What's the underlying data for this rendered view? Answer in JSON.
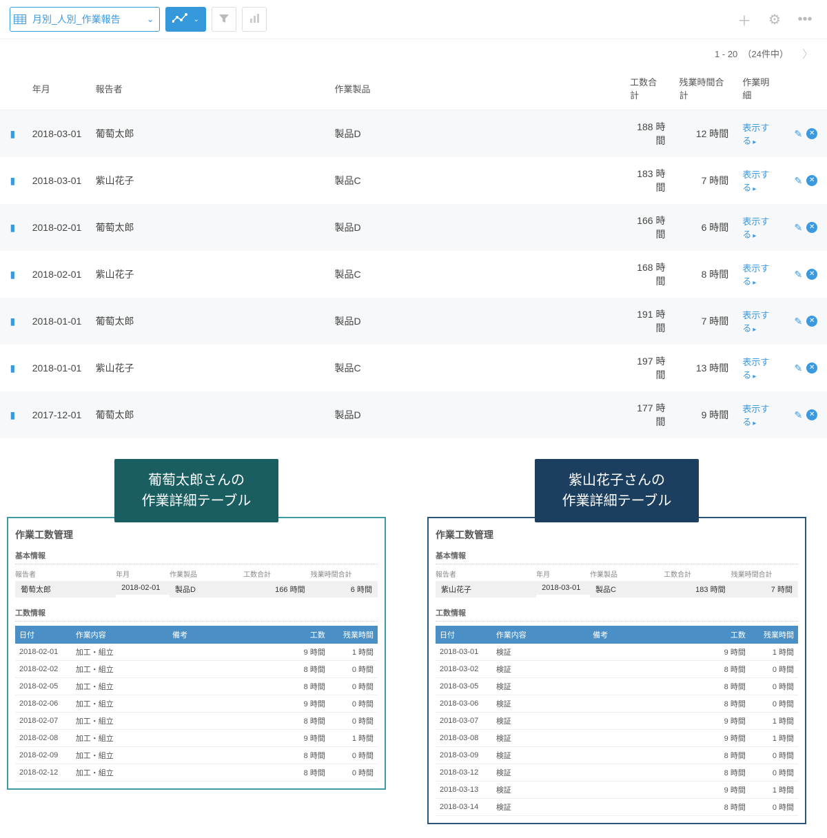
{
  "toolbar": {
    "view_label": "月別_人別_作業報告"
  },
  "pager": {
    "range": "1 - 20",
    "total_label": "（24件中）"
  },
  "columns": {
    "date": "年月",
    "reporter": "報告者",
    "product": "作業製品",
    "hours": "工数合計",
    "overtime": "残業時間合計",
    "detail": "作業明細"
  },
  "detail_link_label": "表示する",
  "unit_hours": "時間",
  "rows": [
    {
      "date": "2018-03-01",
      "reporter": "葡萄太郎",
      "product": "製品D",
      "hours": "188",
      "overtime": "12"
    },
    {
      "date": "2018-03-01",
      "reporter": "紫山花子",
      "product": "製品C",
      "hours": "183",
      "overtime": "7"
    },
    {
      "date": "2018-02-01",
      "reporter": "葡萄太郎",
      "product": "製品D",
      "hours": "166",
      "overtime": "6"
    },
    {
      "date": "2018-02-01",
      "reporter": "紫山花子",
      "product": "製品C",
      "hours": "168",
      "overtime": "8"
    },
    {
      "date": "2018-01-01",
      "reporter": "葡萄太郎",
      "product": "製品D",
      "hours": "191",
      "overtime": "7"
    },
    {
      "date": "2018-01-01",
      "reporter": "紫山花子",
      "product": "製品C",
      "hours": "197",
      "overtime": "13"
    },
    {
      "date": "2017-12-01",
      "reporter": "葡萄太郎",
      "product": "製品D",
      "hours": "177",
      "overtime": "9"
    }
  ],
  "cards": {
    "left": {
      "title_l1": "葡萄太郎さんの",
      "title_l2": "作業詳細テーブル",
      "header": "作業工数管理",
      "section_basic": "基本情報",
      "section_detail": "工数情報",
      "field_labels": {
        "reporter": "報告者",
        "date": "年月",
        "product": "作業製品",
        "hours": "工数合計",
        "overtime": "残業時間合計"
      },
      "fields": {
        "reporter": "葡萄太郎",
        "date": "2018-02-01",
        "product": "製品D",
        "hours": "166 時間",
        "overtime": "6 時間"
      },
      "dc_cols": {
        "date": "日付",
        "work": "作業内容",
        "note": "備考",
        "hours": "工数",
        "overtime": "残業時間"
      },
      "rows": [
        {
          "date": "2018-02-01",
          "work": "加工・組立",
          "note": "",
          "hours": "9 時間",
          "overtime": "1 時間"
        },
        {
          "date": "2018-02-02",
          "work": "加工・組立",
          "note": "",
          "hours": "8 時間",
          "overtime": "0 時間"
        },
        {
          "date": "2018-02-05",
          "work": "加工・組立",
          "note": "",
          "hours": "8 時間",
          "overtime": "0 時間"
        },
        {
          "date": "2018-02-06",
          "work": "加工・組立",
          "note": "",
          "hours": "9 時間",
          "overtime": "0 時間"
        },
        {
          "date": "2018-02-07",
          "work": "加工・組立",
          "note": "",
          "hours": "8 時間",
          "overtime": "0 時間"
        },
        {
          "date": "2018-02-08",
          "work": "加工・組立",
          "note": "",
          "hours": "9 時間",
          "overtime": "1 時間"
        },
        {
          "date": "2018-02-09",
          "work": "加工・組立",
          "note": "",
          "hours": "8 時間",
          "overtime": "0 時間"
        },
        {
          "date": "2018-02-12",
          "work": "加工・組立",
          "note": "",
          "hours": "8 時間",
          "overtime": "0 時間"
        }
      ]
    },
    "right": {
      "title_l1": "紫山花子さんの",
      "title_l2": "作業詳細テーブル",
      "header": "作業工数管理",
      "section_basic": "基本情報",
      "section_detail": "工数情報",
      "field_labels": {
        "reporter": "報告者",
        "date": "年月",
        "product": "作業製品",
        "hours": "工数合計",
        "overtime": "残業時間合計"
      },
      "fields": {
        "reporter": "紫山花子",
        "date": "2018-03-01",
        "product": "製品C",
        "hours": "183 時間",
        "overtime": "7 時間"
      },
      "dc_cols": {
        "date": "日付",
        "work": "作業内容",
        "note": "備考",
        "hours": "工数",
        "overtime": "残業時間"
      },
      "rows": [
        {
          "date": "2018-03-01",
          "work": "検証",
          "note": "",
          "hours": "9 時間",
          "overtime": "1 時間"
        },
        {
          "date": "2018-03-02",
          "work": "検証",
          "note": "",
          "hours": "8 時間",
          "overtime": "0 時間"
        },
        {
          "date": "2018-03-05",
          "work": "検証",
          "note": "",
          "hours": "8 時間",
          "overtime": "0 時間"
        },
        {
          "date": "2018-03-06",
          "work": "検証",
          "note": "",
          "hours": "8 時間",
          "overtime": "0 時間"
        },
        {
          "date": "2018-03-07",
          "work": "検証",
          "note": "",
          "hours": "9 時間",
          "overtime": "1 時間"
        },
        {
          "date": "2018-03-08",
          "work": "検証",
          "note": "",
          "hours": "9 時間",
          "overtime": "1 時間"
        },
        {
          "date": "2018-03-09",
          "work": "検証",
          "note": "",
          "hours": "8 時間",
          "overtime": "0 時間"
        },
        {
          "date": "2018-03-12",
          "work": "検証",
          "note": "",
          "hours": "8 時間",
          "overtime": "0 時間"
        },
        {
          "date": "2018-03-13",
          "work": "検証",
          "note": "",
          "hours": "9 時間",
          "overtime": "1 時間"
        },
        {
          "date": "2018-03-14",
          "work": "検証",
          "note": "",
          "hours": "8 時間",
          "overtime": "0 時間"
        }
      ]
    }
  }
}
